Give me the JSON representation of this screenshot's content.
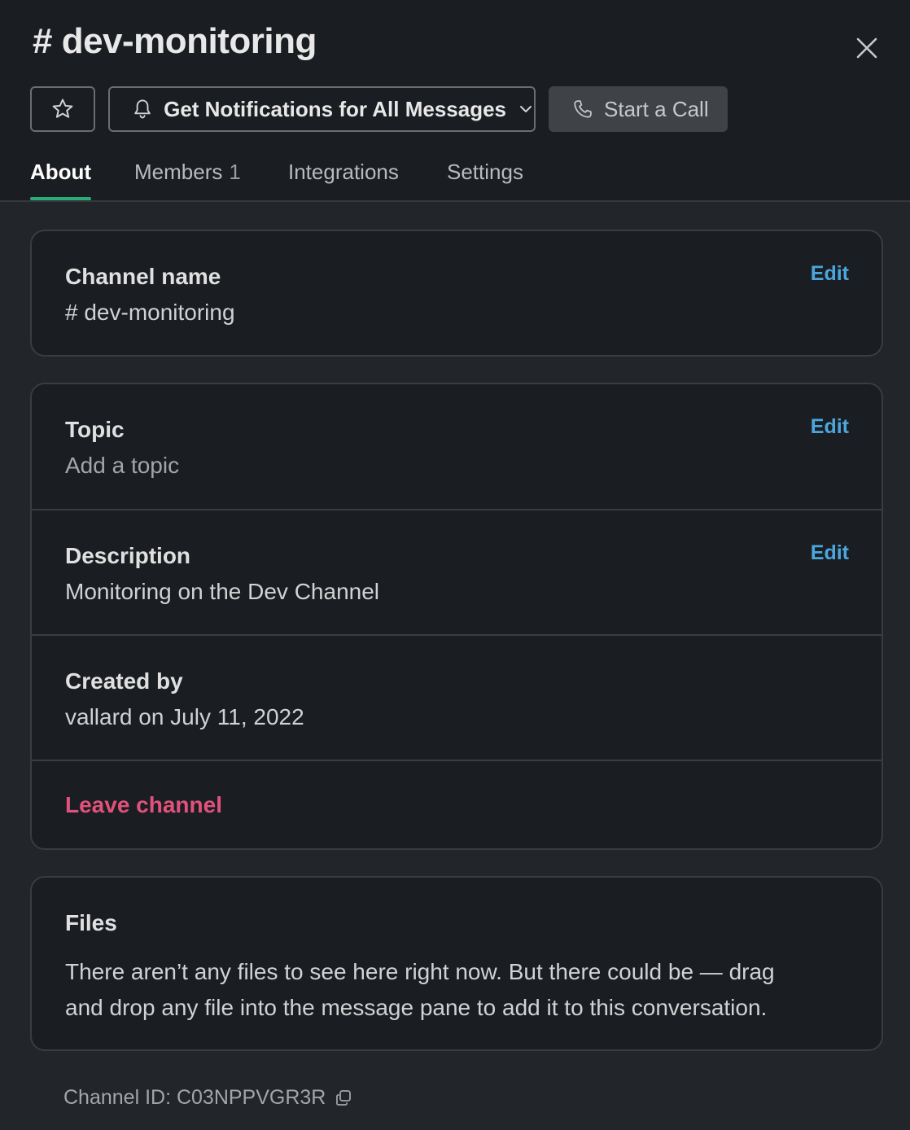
{
  "header": {
    "title": "# dev-monitoring",
    "star_icon": "star-icon",
    "notifications_label": "Get Notifications for All Messages",
    "call_label": "Start a Call",
    "close_icon": "close-icon"
  },
  "tabs": [
    {
      "label": "About",
      "active": true
    },
    {
      "label": "Members",
      "count": "1"
    },
    {
      "label": "Integrations"
    },
    {
      "label": "Settings"
    }
  ],
  "about": {
    "channel_name": {
      "label": "Channel name",
      "value": "# dev-monitoring",
      "edit": "Edit"
    },
    "topic": {
      "label": "Topic",
      "value": "Add a topic",
      "edit": "Edit"
    },
    "description": {
      "label": "Description",
      "value": "Monitoring on the Dev Channel",
      "edit": "Edit"
    },
    "created_by": {
      "label": "Created by",
      "value": "vallard on July 11, 2022"
    },
    "leave_label": "Leave channel"
  },
  "files": {
    "label": "Files",
    "line1": "There aren’t any files to see here right now. But there could be — drag",
    "line2": "and drop any file into the message pane to add it to this conversation."
  },
  "footer": {
    "channel_id": "Channel ID: C03NPPVGR3R"
  },
  "colors": {
    "accent_tab": "#2bac76",
    "link": "#4ba6dd",
    "danger": "#e0527b"
  }
}
